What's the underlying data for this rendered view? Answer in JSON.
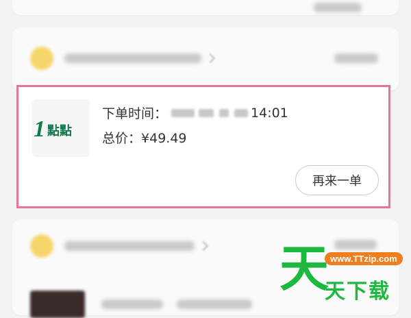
{
  "order": {
    "time_label": "下单时间：",
    "time_value": "14:01",
    "total_label": "总价：",
    "total_value": "¥49.49",
    "reorder_label": "再来一单"
  },
  "shop": {
    "logo_text": "1點點",
    "logo_color": "#0f7a4c"
  },
  "highlight_color": "#e8739a",
  "watermark": {
    "big_char": "天",
    "url": "www.TTzip.com",
    "small_text": "天下载"
  }
}
